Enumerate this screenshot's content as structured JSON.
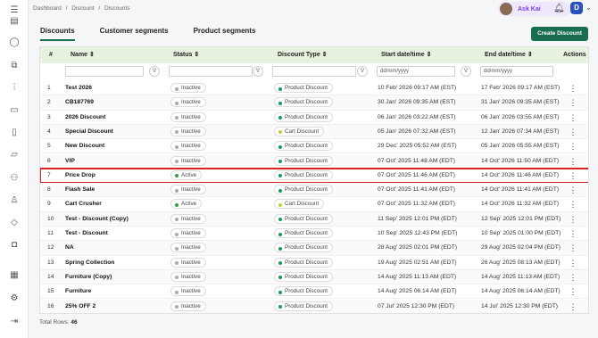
{
  "breadcrumb": [
    "Dashboard",
    "/",
    "Discount",
    "/",
    "Discounts"
  ],
  "header": {
    "ask_label": "Ask Kai",
    "user_initial": "D"
  },
  "tabs": [
    "Discounts",
    "Customer segments",
    "Product segments"
  ],
  "create_button": "Create Discount",
  "columns": {
    "num": "#",
    "name": "Name",
    "status": "Status",
    "type": "Discount Type",
    "start": "Start date/time",
    "end": "End date/time",
    "actions": "Actions"
  },
  "filters": {
    "date_placeholder": "dd/mm/yyyy"
  },
  "colors": {
    "accent": "#1a6e50",
    "active": "#3b9a4a",
    "inactive": "#aaaaaa",
    "product": "#1a9b54",
    "cart": "#c9c93a",
    "highlight": "#e02020"
  },
  "rows": [
    {
      "num": "1",
      "name": "Test 2026",
      "status": "Inactive",
      "type": "Product Discount",
      "start": "10 Feb' 2026 09:17 AM (EST)",
      "end": "17 Feb' 2026 09:17 AM (EST)"
    },
    {
      "num": "2",
      "name": "CB187769",
      "status": "Inactive",
      "type": "Product Discount",
      "start": "30 Jan' 2026 09:35 AM (EST)",
      "end": "31 Jan' 2026 09:35 AM (EST)"
    },
    {
      "num": "3",
      "name": "2026 Discount",
      "status": "Inactive",
      "type": "Product Discount",
      "start": "06 Jan' 2026 03:22 AM (EST)",
      "end": "06 Jan' 2026 03:55 AM (EST)"
    },
    {
      "num": "4",
      "name": "Special Discount",
      "status": "Inactive",
      "type": "Cart Discount",
      "start": "05 Jan' 2026 07:32 AM (EST)",
      "end": "12 Jan' 2026 07:34 AM (EST)"
    },
    {
      "num": "5",
      "name": "New Discount",
      "status": "Inactive",
      "type": "Product Discount",
      "start": "29 Dec' 2025 05:52 AM (EST)",
      "end": "05 Jan' 2026 05:55 AM (EST)"
    },
    {
      "num": "6",
      "name": "VIP",
      "status": "Inactive",
      "type": "Product Discount",
      "start": "07 Oct' 2025 11:48 AM (EDT)",
      "end": "14 Oct' 2026 11:50 AM (EDT)"
    },
    {
      "num": "7",
      "name": "Price Drop",
      "status": "Active",
      "type": "Product Discount",
      "start": "07 Oct' 2025 11:46 AM (EDT)",
      "end": "14 Oct' 2026 11:46 AM (EDT)"
    },
    {
      "num": "8",
      "name": "Flash Sale",
      "status": "Inactive",
      "type": "Product Discount",
      "start": "07 Oct' 2025 11:41 AM (EDT)",
      "end": "14 Oct' 2026 11:41 AM (EDT)"
    },
    {
      "num": "9",
      "name": "Cart Crusher",
      "status": "Active",
      "type": "Cart Discount",
      "start": "07 Oct' 2025 11:32 AM (EDT)",
      "end": "14 Oct' 2026 11:32 AM (EDT)"
    },
    {
      "num": "10",
      "name": "Test - Discount (Copy)",
      "status": "Inactive",
      "type": "Product Discount",
      "start": "11 Sep' 2025 12:01 PM (EDT)",
      "end": "12 Sep' 2025 12:01 PM (EDT)"
    },
    {
      "num": "11",
      "name": "Test - Discount",
      "status": "Inactive",
      "type": "Product Discount",
      "start": "10 Sep' 2025 12:43 PM (EDT)",
      "end": "10 Sep' 2025 01:00 PM (EDT)"
    },
    {
      "num": "12",
      "name": "NA",
      "status": "Inactive",
      "type": "Product Discount",
      "start": "28 Aug' 2025 02:01 PM (EDT)",
      "end": "29 Aug' 2025 02:04 PM (EDT)"
    },
    {
      "num": "13",
      "name": "Spring Collection",
      "status": "Inactive",
      "type": "Product Discount",
      "start": "19 Aug' 2025 02:51 AM (EDT)",
      "end": "26 Aug' 2025 08:13 AM (EDT)"
    },
    {
      "num": "14",
      "name": "Furniture (Copy)",
      "status": "Inactive",
      "type": "Product Discount",
      "start": "14 Aug' 2025 11:13 AM (EDT)",
      "end": "14 Aug' 2025 11:13 AM (EDT)"
    },
    {
      "num": "15",
      "name": "Furniture",
      "status": "Inactive",
      "type": "Product Discount",
      "start": "14 Aug' 2025 06:14 AM (EDT)",
      "end": "14 Aug' 2025 06:14 AM (EDT)"
    },
    {
      "num": "16",
      "name": "25% OFF 2",
      "status": "Inactive",
      "type": "Product Discount",
      "start": "07 Jul' 2025 12:30 PM (EDT)",
      "end": "14 Jul' 2025 12:30 PM (EDT)"
    }
  ],
  "footer": {
    "label": "Total Rows:",
    "count": "46"
  }
}
